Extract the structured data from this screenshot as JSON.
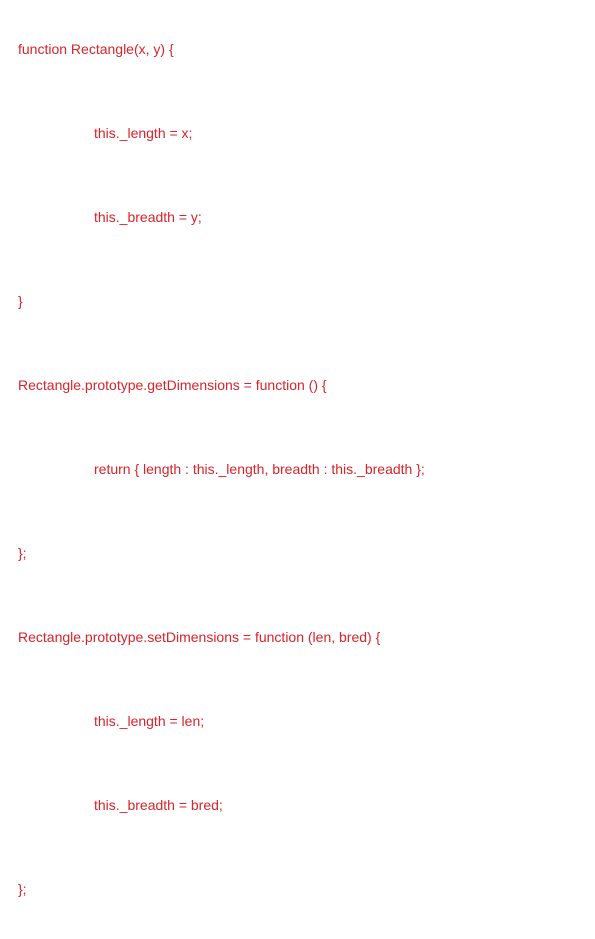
{
  "code": {
    "l1": "function Rectangle(x, y) {",
    "l2": "this._length = x;",
    "l3": "this._breadth = y;",
    "l4": "}",
    "l5": "Rectangle.prototype.getDimensions = function () {",
    "l6": "return { length : this._length, breadth : this._breadth };",
    "l7": "};",
    "l8": "Rectangle.prototype.setDimensions = function (len, bred) {",
    "l9": "this._length = len;",
    "l10": "this._breadth = bred;",
    "l11": "};"
  }
}
